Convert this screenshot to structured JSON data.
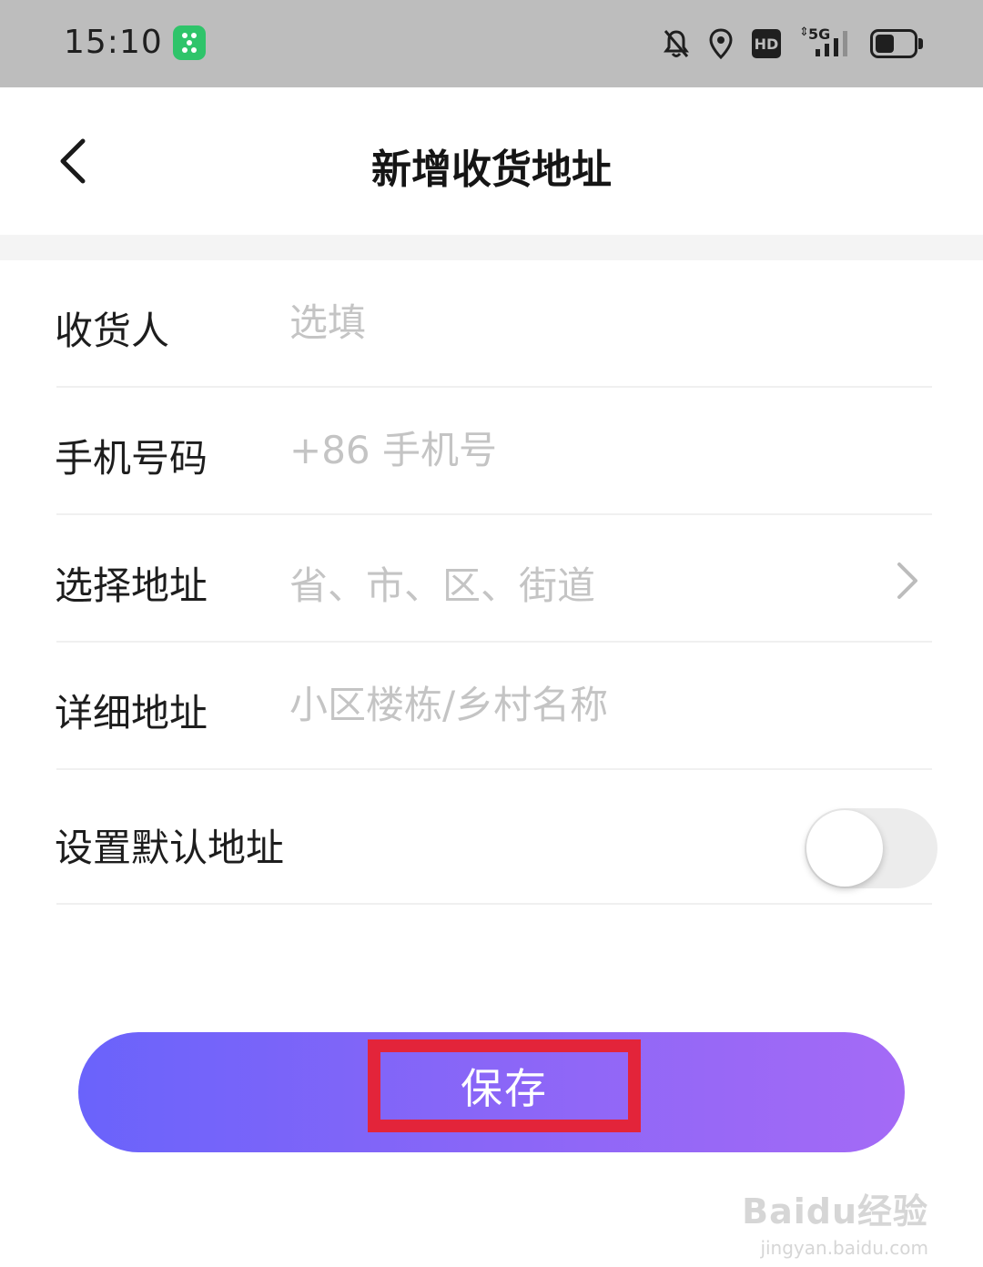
{
  "status_bar": {
    "time": "15:10",
    "icons": [
      "notifications-muted-icon",
      "location-icon",
      "hd-icon",
      "5g-signal-icon",
      "battery-icon"
    ],
    "hd_label": "HD",
    "network_label": "5G"
  },
  "header": {
    "back_icon": "chevron-left-icon",
    "title": "新增收货地址"
  },
  "form": {
    "recipient": {
      "label": "收货人",
      "placeholder": "选填"
    },
    "phone": {
      "label": "手机号码",
      "placeholder": "+86 手机号"
    },
    "region": {
      "label": "选择地址",
      "placeholder": "省、市、区、街道"
    },
    "detail": {
      "label": "详细地址",
      "placeholder": "小区楼栋/乡村名称"
    },
    "default_address": {
      "label": "设置默认地址",
      "enabled": false
    }
  },
  "save": {
    "label": "保存"
  },
  "watermark": {
    "logo": "Baidu经验",
    "url": "jingyan.baidu.com"
  },
  "colors": {
    "status_bar_bg": "#bdbdbd",
    "button_gradient_start": "#6a63fb",
    "button_gradient_end": "#a46af6",
    "highlight_box": "#e3243a",
    "placeholder_text": "#c4c4c4"
  }
}
